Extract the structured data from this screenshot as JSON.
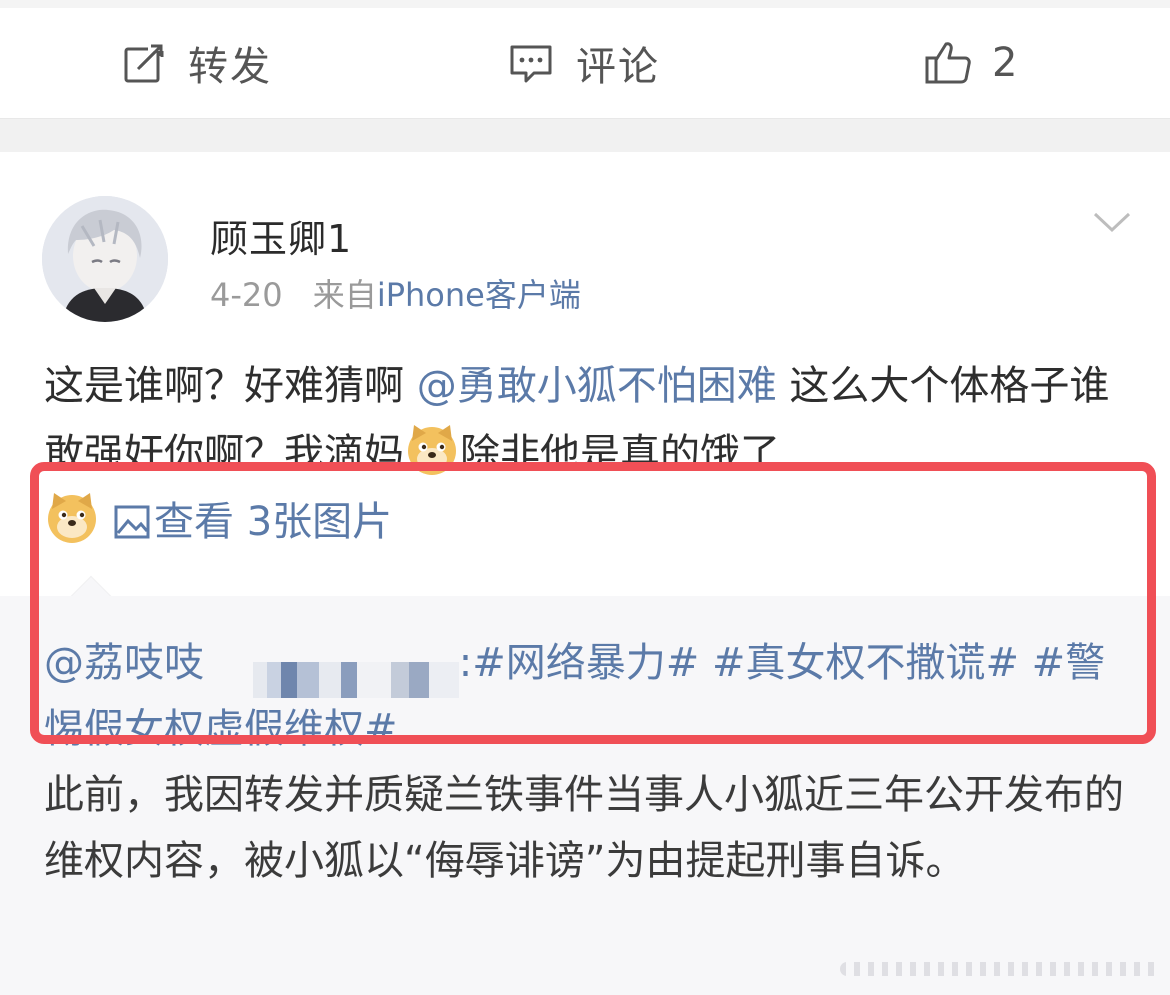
{
  "actions": {
    "repost": {
      "label": "转发",
      "icon": "repost-icon"
    },
    "comment": {
      "label": "评论",
      "icon": "comment-icon"
    },
    "like": {
      "label": "2",
      "icon": "thumbs-up-icon"
    }
  },
  "post": {
    "user": {
      "name": "顾玉卿1",
      "avatar": "avatar"
    },
    "date": "4-20",
    "source_prefix": "来自",
    "source": "iPhone客户端",
    "text_1": "这是谁啊？好难猜啊 ",
    "mention": "@勇敢小狐不怕困难",
    "text_2": " 这么大个体格子谁敢强奸你啊？我滴妈",
    "text_3": "除非他是真的饿了",
    "view_images": "查看 3张图片",
    "emoji": "doge-emoji"
  },
  "quoted": {
    "mention": "@荔吱吱",
    "hashtags": ":#网络暴力# #真女权不撒谎# #警惕假女权虚假维权#",
    "body": "此前，我因转发并质疑兰铁事件当事人小狐近三年公开发布的维权内容，被小狐以“侮辱诽谤”为由提起刑事自诉。"
  },
  "colors": {
    "link": "#5b7aa8",
    "highlight": "#f04f56",
    "background_gray": "#f1f1f1"
  }
}
